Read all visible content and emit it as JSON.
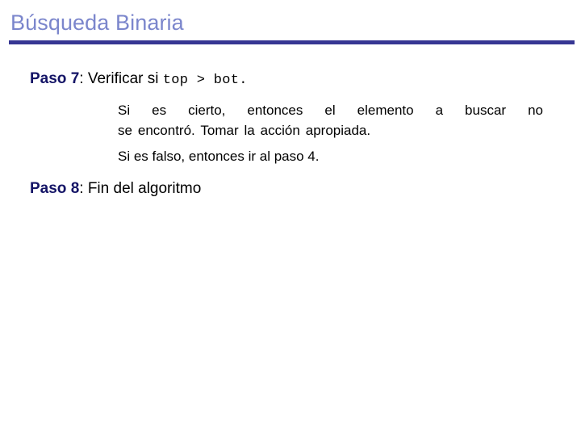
{
  "slide": {
    "title": "Búsqueda Binaria",
    "title_color": "#7b86cc",
    "rule_color": "#363693",
    "step_label_color": "#141466",
    "body_text_color": "#000000",
    "background_color": "#ffffff"
  },
  "steps": [
    {
      "label": "Paso 7",
      "separator": ":",
      "text_before_code": " Verificar si ",
      "code": "top  >  bot.",
      "sub_items": [
        {
          "line_one": "Si es cierto, entonces el elemento a buscar no",
          "line_two": "se encontró. Tomar la acción apropiada.",
          "full": "Si es cierto, entonces el elemento a buscar no se encontró. Tomar la acción apropiada."
        },
        {
          "full": "Si es falso, entonces ir al paso 4."
        }
      ]
    },
    {
      "label": "Paso 8",
      "separator": ":",
      "text_before_code": " Fin del algoritmo",
      "code": "",
      "sub_items": []
    }
  ]
}
